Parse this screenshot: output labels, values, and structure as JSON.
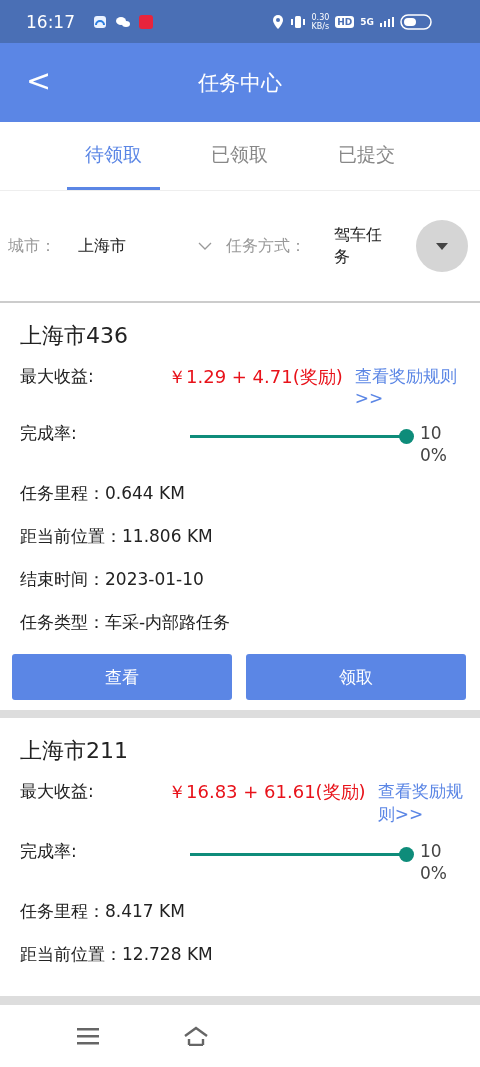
{
  "status_bar": {
    "time": "16:17",
    "speed": "0.30",
    "speed_unit": "KB/s",
    "hd": "HD",
    "network": "5G"
  },
  "header": {
    "back": "<",
    "title": "任务中心"
  },
  "tabs": [
    {
      "label": "待领取",
      "selected": true
    },
    {
      "label": "已领取",
      "selected": false
    },
    {
      "label": "已提交",
      "selected": false
    }
  ],
  "filters": {
    "city_label": "城市：",
    "city_value": "上海市",
    "mode_label": "任务方式：",
    "mode_value": "驾车任务"
  },
  "tasks": [
    {
      "title": "上海市436",
      "income_label": "最大收益:",
      "income": "￥1.29 + 4.71(奖励)",
      "rule_link": "查看奖励规则>>",
      "rate_label": "完成率:",
      "level": 1,
      "rate": "100%",
      "fields": [
        {
          "label": "任务里程：",
          "value": "0.644 KM"
        },
        {
          "label": "距当前位置：",
          "value": "11.806  KM"
        },
        {
          "label": "结束时间：",
          "value": "2023-01-10"
        },
        {
          "label": "任务类型：",
          "value": "车采-内部路任务"
        }
      ],
      "buttons": [
        "查看",
        "领取"
      ]
    },
    {
      "title": "上海市211",
      "income_label": "最大收益:",
      "income": "￥16.83 + 61.61(奖励)",
      "rule_link": "查看奖励规则>>",
      "rate_label": "完成率:",
      "level": 1,
      "rate": "100%",
      "fields": [
        {
          "label": "任务里程：",
          "value": "8.417 KM"
        },
        {
          "label": "距当前位置：",
          "value": "12.728  KM"
        }
      ]
    }
  ]
}
